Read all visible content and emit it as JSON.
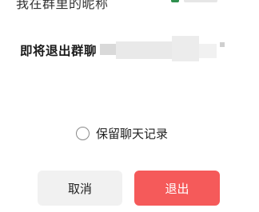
{
  "background_text": "我在群里的昵称",
  "dialog": {
    "title": "即将退出群聊",
    "title_suffix_redacted": true,
    "keep_history_option": {
      "label": "保留聊天记录",
      "checked": false
    },
    "buttons": {
      "cancel_label": "取消",
      "exit_label": "退出"
    }
  },
  "colors": {
    "exit_button": "#f55a5a",
    "cancel_button": "#f1f1f1",
    "title_text": "#1a1a1a"
  }
}
